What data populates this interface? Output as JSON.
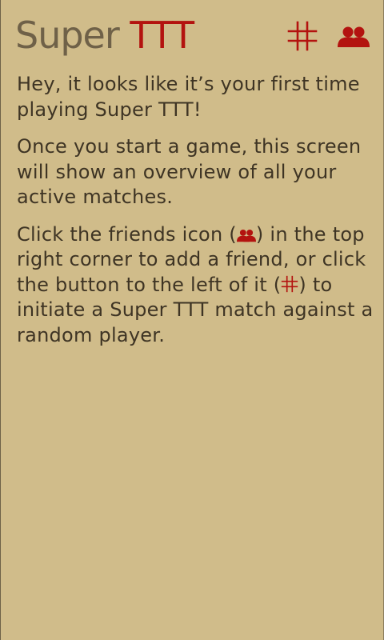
{
  "app": {
    "title_part1": "Super ",
    "title_part2": "TTT"
  },
  "header": {
    "new_game_icon": "grid-hash-icon",
    "friends_icon": "friends-icon",
    "accent_color": "#b3130f"
  },
  "intro": {
    "p1": "Hey, it looks like it’s your first time playing Super TTT!",
    "p2": "Once you start a game, this screen will show an overview of all your active matches.",
    "p3_a": "Click the friends icon (",
    "p3_b": ") in the top right corner to add a friend, or click the button to the left of it (",
    "p3_c": ") to initiate a Super TTT match against a random player."
  },
  "colors": {
    "background": "#d0bc8a",
    "text": "#3e3424",
    "title_gray": "#6f6148",
    "accent_red": "#b3130f"
  }
}
